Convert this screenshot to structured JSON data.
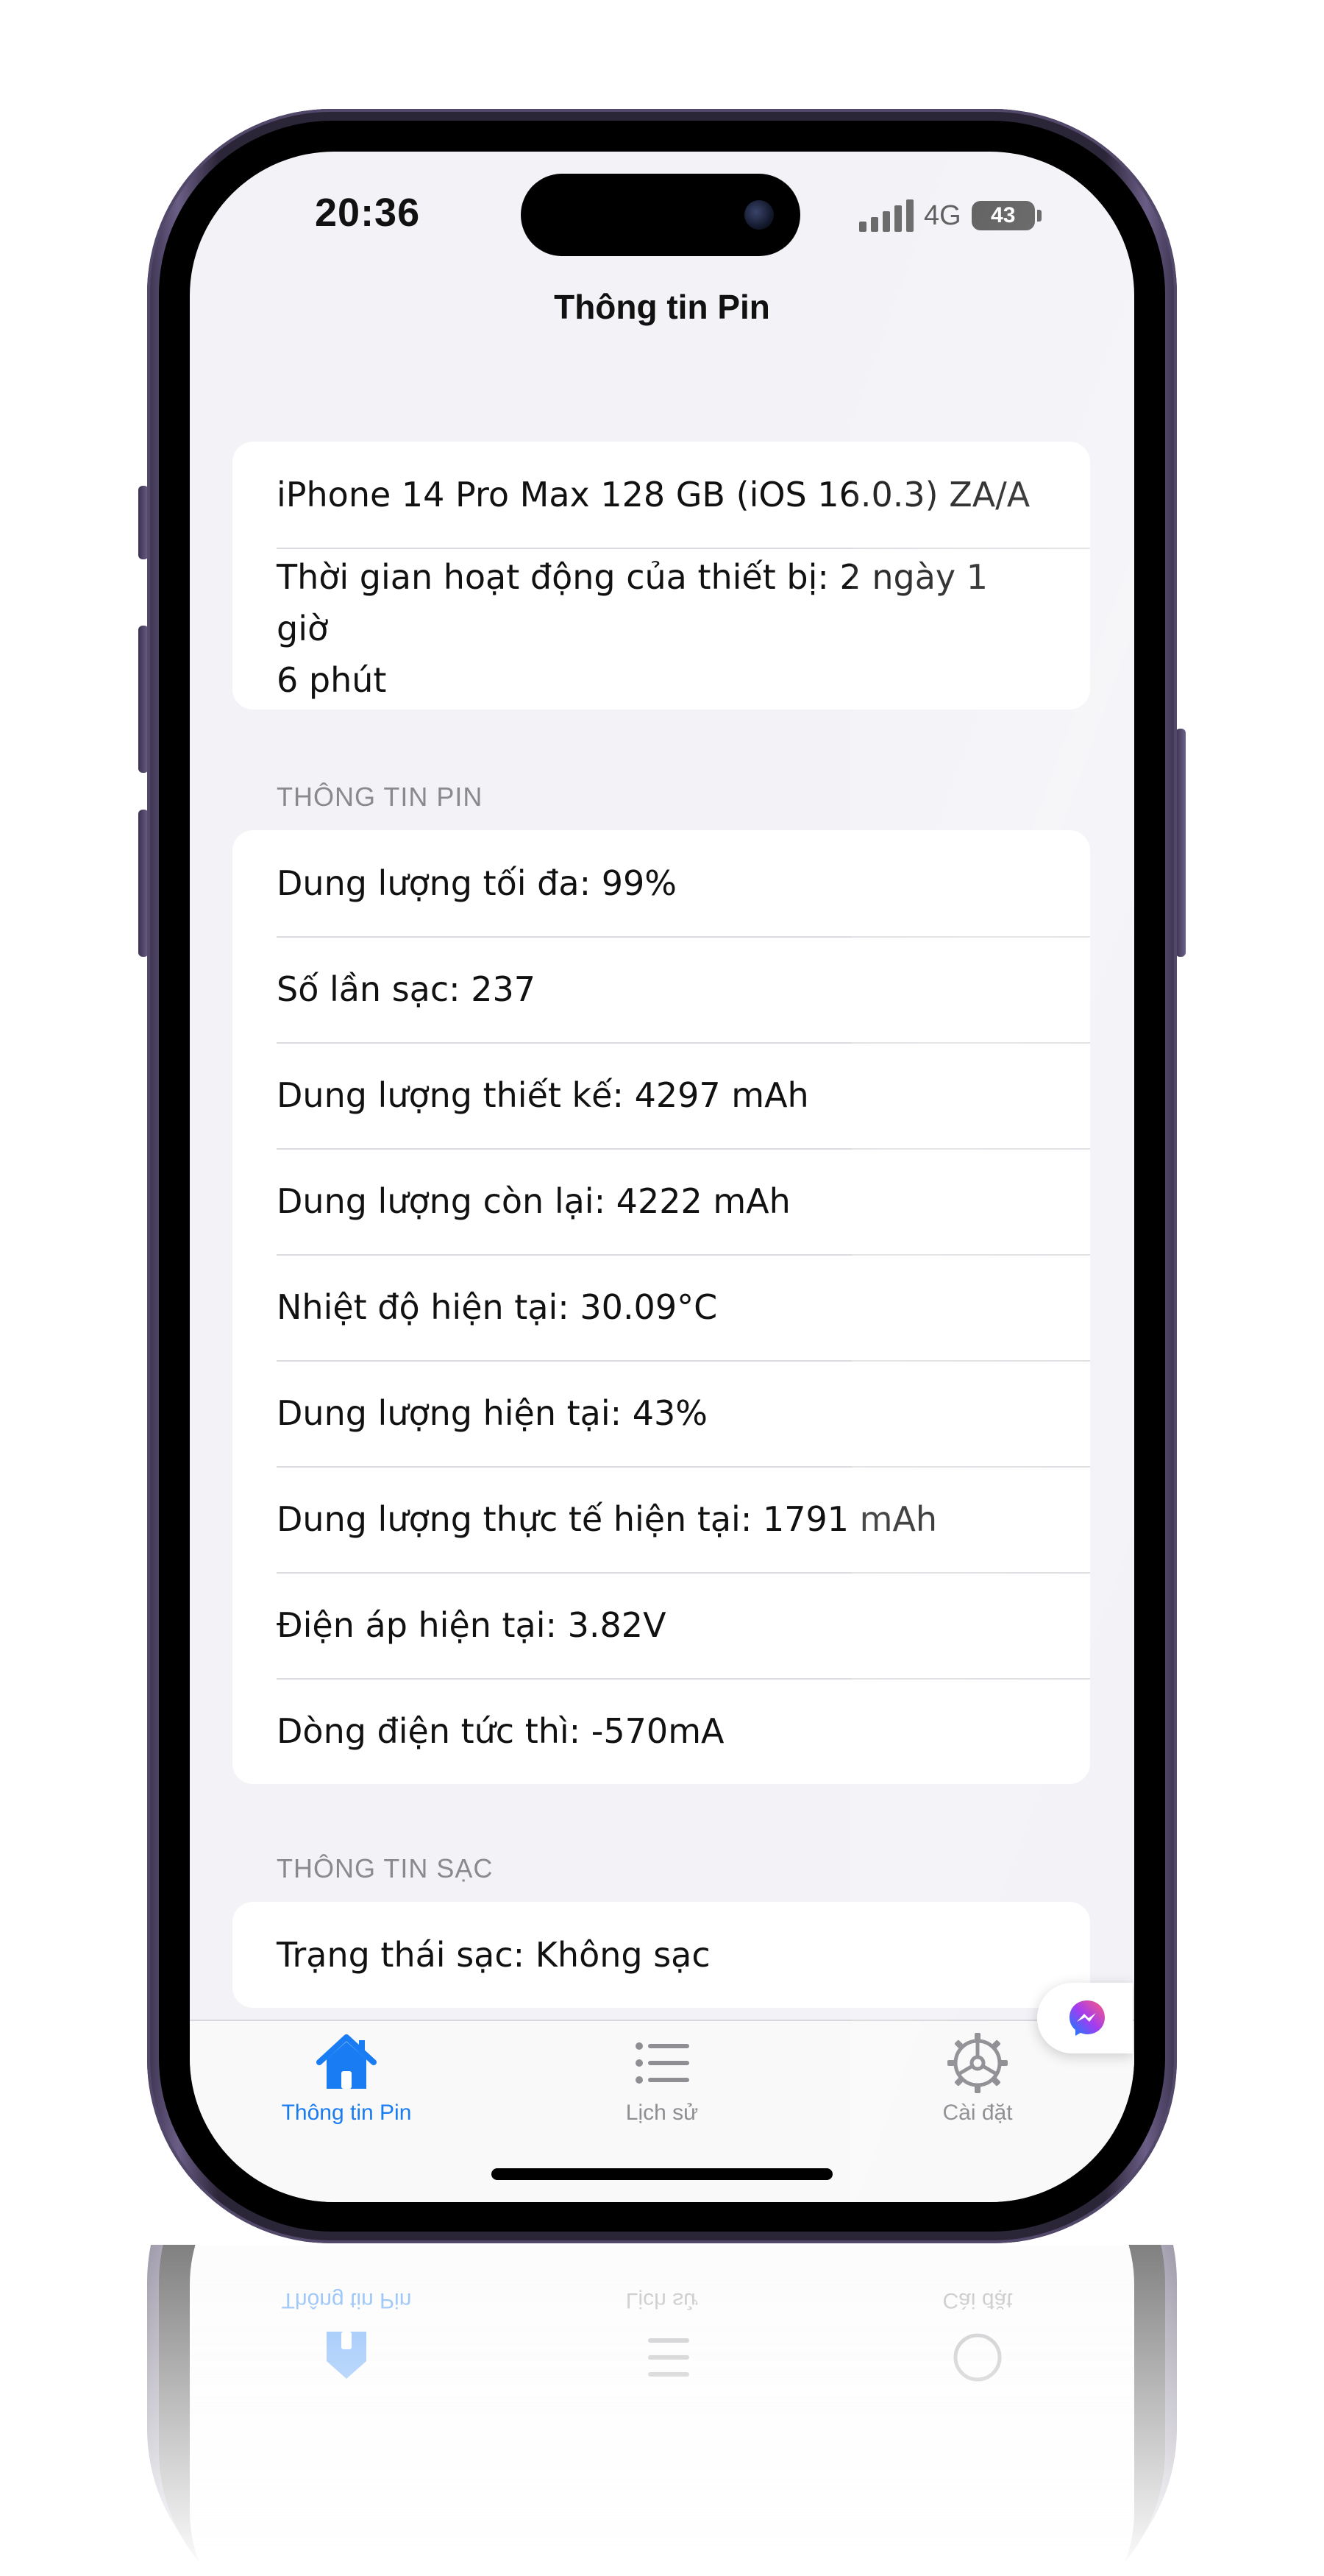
{
  "status_bar": {
    "time": "20:36",
    "network": "4G",
    "battery_level": "43"
  },
  "nav": {
    "title": "Thông tin Pin"
  },
  "device": {
    "model": "iPhone 14 Pro Max 128 GB (iOS 16.0.3) ZA/A",
    "uptime_line1": "Thời gian hoạt động của thiết bị: 2 ngày 1 giờ",
    "uptime_line2": "6 phút"
  },
  "battery_section": {
    "header": "THÔNG TIN PIN",
    "rows": [
      "Dung lượng tối đa: 99%",
      "Số lần sạc: 237",
      "Dung lượng thiết kế: 4297 mAh",
      "Dung lượng còn lại: 4222 mAh",
      "Nhiệt độ hiện tại: 30.09°C",
      "Dung lượng hiện tại: 43%",
      "Dung lượng thực tế hiện tại: 1791 mAh",
      "Điện áp hiện tại: 3.82V",
      "Dòng điện tức thì: -570mA"
    ]
  },
  "charging_section": {
    "header": "THÔNG TIN SẠC",
    "rows": [
      "Trạng thái sạc: Không sạc"
    ]
  },
  "tabbar": {
    "tabs": [
      {
        "label": "Thông tin Pin",
        "icon": "house-icon",
        "active": true
      },
      {
        "label": "Lịch sử",
        "icon": "list-icon",
        "active": false
      },
      {
        "label": "Cài đặt",
        "icon": "gear-icon",
        "active": false
      }
    ]
  },
  "colors": {
    "accent": "#1a7cf2",
    "inactive": "#8e8e93",
    "background": "#f2f2f7",
    "card": "#ffffff"
  }
}
